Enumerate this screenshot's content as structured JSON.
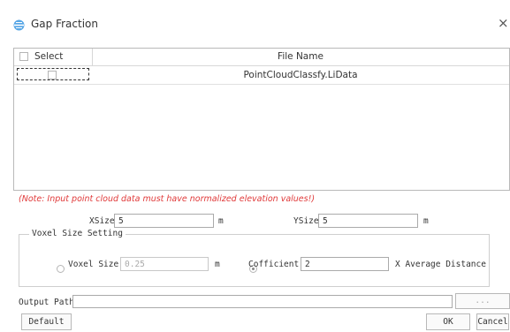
{
  "window": {
    "title": "Gap Fraction",
    "close_glyph": "×"
  },
  "table": {
    "header_select": "Select",
    "header_file": "File Name",
    "rows": [
      {
        "file_name": "PointCloudClassfy.LiData"
      }
    ]
  },
  "note": "(Note: Input point cloud data must have normalized elevation values!)",
  "xsize": {
    "label": "XSize",
    "value": "5",
    "unit": "m"
  },
  "ysize": {
    "label": "YSize",
    "value": "5",
    "unit": "m"
  },
  "voxel_group": {
    "title": "Voxel Size Setting",
    "voxel_option": {
      "label": "Voxel Size",
      "value": "0.25",
      "unit": "m",
      "selected": false
    },
    "coefficient_option": {
      "label": "Cofficient",
      "value": "2",
      "suffix": "X Average Distance",
      "selected": true
    }
  },
  "output_path": {
    "label": "Output Path",
    "value": "",
    "browse_label": "..."
  },
  "buttons": {
    "default": "Default",
    "ok": "OK",
    "cancel": "Cancel"
  },
  "icons": {
    "app": "gap-fraction-app-icon",
    "close": "close-icon"
  }
}
